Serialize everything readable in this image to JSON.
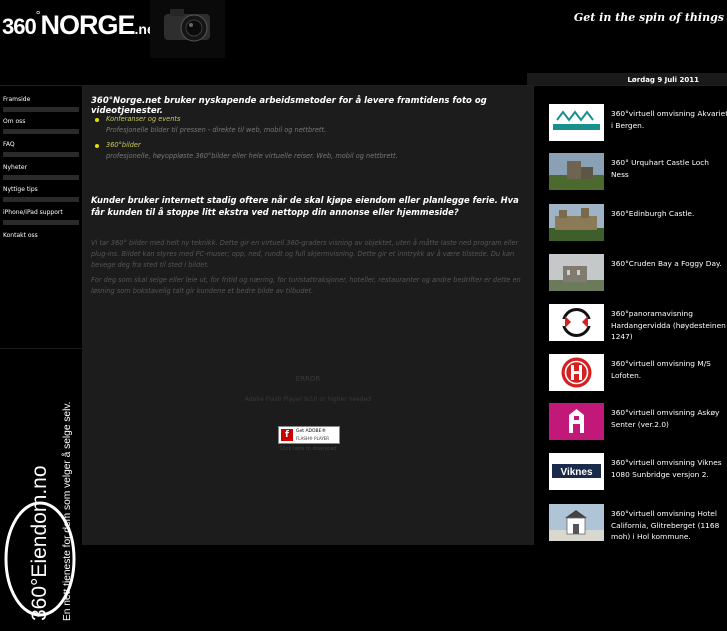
{
  "header": {
    "logo": {
      "num": "360",
      "deg": "°",
      "norge": "NORGE",
      "tld": ".net"
    },
    "tagline": "Get in the spin of things",
    "date": "Lørdag 9 Juli 2011"
  },
  "nav": {
    "items": [
      {
        "label": "Framside"
      },
      {
        "label": "Om oss"
      },
      {
        "label": "FAQ"
      },
      {
        "label": "Nyheter"
      },
      {
        "label": "Nyttige tips"
      },
      {
        "label": "iPhone/iPad support"
      },
      {
        "label": "Kontakt oss"
      }
    ]
  },
  "promo": {
    "brand": "360°Eiendom.no",
    "slogan1": "En nett tjeneste for dem som velger å selge selv."
  },
  "main": {
    "headline1": "360°Norge.net bruker nyskapende arbeidsmetoder for å levere framtidens foto og videotjenester.",
    "bullets": [
      {
        "title": "Konferanser og events",
        "text": "Profesjonelle bilder til pressen - direkte til web, mobil og nettbrett."
      },
      {
        "title": "360°bilder",
        "text": "profesjonelle, høyoppløste 360°bilder eller hele virtuelle reiser. Web, mobil og nettbrett."
      }
    ],
    "headline2": "Kunder bruker internett stadig oftere når de skal kjøpe eiendom eller planlegge ferie. Hva får kunden til å stoppe litt ekstra ved nettopp din annonse eller hjemmeside?",
    "para1": "Vi tar 360° bilder med helt ny teknikk. Dette gir en virtuell 360-graders visning av objektet, uten å måtte laste ned program eller plug-ins. Bildet kan styres med PC-muser; opp, ned, rundt og full skjermvisning. Dette gir et inntrykk av å være tilstede. Du kan bevege deg fra sted til sted i bildet.",
    "para2": "For deg som skal selge eller leie ut, for fritid og næring, for turistattraksjoner, hoteller, restauranter og andre bedrifter er dette en løsning som bokstavelig talt gir kundene et bedre bilde av tilbudet.",
    "flash": {
      "error": "ERROR",
      "needed": "Adobe Flash Player 9/10 or higher needed",
      "badge_line1": "Get ADOBE®",
      "badge_line2": "FLASH® PLAYER",
      "link": "Click here to download"
    }
  },
  "tours": [
    {
      "label": "360°virtuell omvisning Akvariet i Bergen.",
      "thumb": "akvariet-logo"
    },
    {
      "label": "360° Urquhart Castle Loch Ness",
      "thumb": "castle-photo"
    },
    {
      "label": "360°Edinburgh Castle.",
      "thumb": "castle-photo"
    },
    {
      "label": "360°Cruden Bay a Foggy Day.",
      "thumb": "foggy-ruin-photo"
    },
    {
      "label": "360°panoramavisning Hardangervidda (høydesteinen 1247)",
      "thumb": "panorama-logo"
    },
    {
      "label": "360°virtuell omvisning M/S Lofoten.",
      "thumb": "hurtigruten-logo"
    },
    {
      "label": "360°virtuell omvisning Askøy Senter (ver.2.0)",
      "thumb": "askoy-logo"
    },
    {
      "label": "360°virtuell omvisning Viknes 1080 Sunbridge versjon 2.",
      "thumb": "viknes-logo"
    },
    {
      "label": "360°virtuell omvisning Hotel California, Glitreberget (1168 moh) i Hol kommune.",
      "thumb": "cabin-photo"
    }
  ],
  "colors": {
    "background": "#000000",
    "main_panel": "#1c1c1c",
    "bullet_dot": "#e0e000",
    "bullet_title": "#c9c95a",
    "akvariet_teal": "#1a8f8f",
    "hurtigruten_red": "#d42020",
    "askoy_magenta": "#c2187a"
  }
}
